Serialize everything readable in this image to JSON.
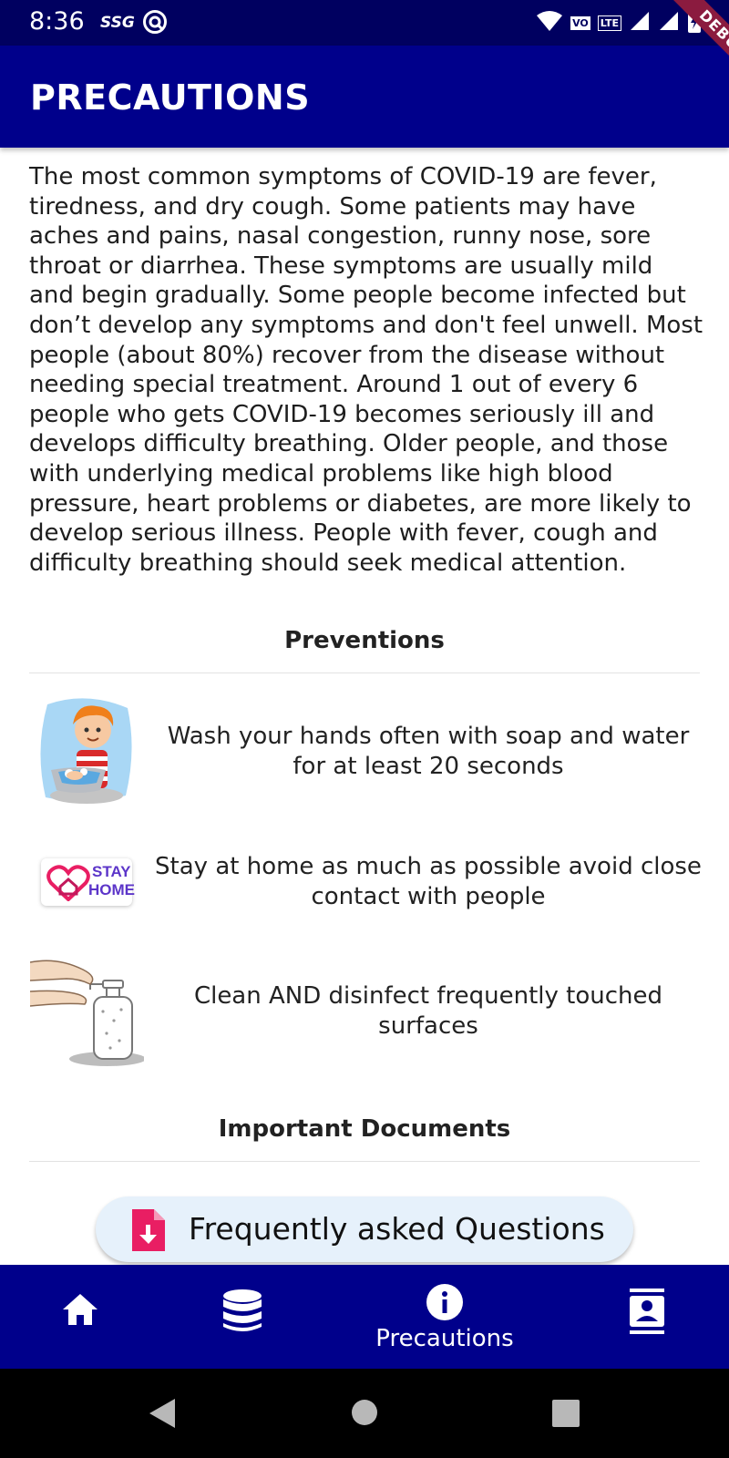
{
  "status_bar": {
    "time": "8:36",
    "carrier_tag": "SSG",
    "vo": "VO",
    "lte": "LTE"
  },
  "debug_banner": "DEBUG",
  "app_bar": {
    "title": "PRECAUTIONS"
  },
  "intro_text": "The most common symptoms of COVID-19 are fever, tiredness, and dry cough. Some patients may have aches and pains, nasal congestion, runny nose, sore throat or diarrhea. These symptoms are usually mild and begin gradually. Some people become infected but don’t develop any symptoms and don't feel unwell. Most people (about 80%) recover from the disease without needing special treatment. Around 1 out of every 6 people who gets COVID-19 becomes seriously ill and develops difficulty breathing. Older people, and those with underlying medical problems like high blood pressure, heart problems or diabetes, are more likely to develop serious illness. People with fever, cough and difficulty breathing should seek medical attention.",
  "preventions": {
    "title": "Preventions",
    "items": [
      {
        "text": "Wash your hands often with soap and water for at least 20 seconds",
        "icon": "boy-washing-hands-illustration"
      },
      {
        "text": "Stay at home as much as possible avoid close contact with people",
        "icon": "stay-home-badge",
        "badge_line1": "STAY",
        "badge_line2": "HOME"
      },
      {
        "text": "Clean AND disinfect frequently touched surfaces",
        "icon": "hand-sanitizer-illustration"
      }
    ]
  },
  "documents": {
    "title": "Important Documents",
    "faq_button": "Frequently asked Questions"
  },
  "bottom_nav": {
    "items": [
      {
        "name": "home",
        "icon": "home-icon",
        "label": ""
      },
      {
        "name": "database",
        "icon": "database-icon",
        "label": ""
      },
      {
        "name": "precautions",
        "icon": "info-icon",
        "label": "Precautions",
        "active": true
      },
      {
        "name": "contacts",
        "icon": "contact-icon",
        "label": ""
      }
    ]
  },
  "colors": {
    "status_bar": "#000060",
    "app_bar": "#00008b",
    "faq_button_bg": "#e6f1fb",
    "accent_pink": "#e91e63",
    "debug_ribbon": "#8b1b3f"
  }
}
